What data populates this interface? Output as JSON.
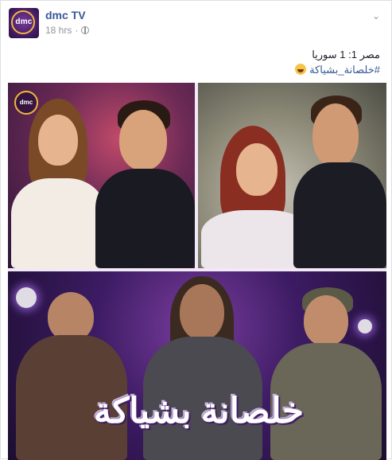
{
  "post": {
    "page_name": "dmc TV",
    "timestamp": "18 hrs",
    "text_line1": "مصر 1: 1 سوريا",
    "hashtag": "#خلصانة_بشياكة"
  },
  "avatar": {
    "logo_text": "dmc"
  },
  "image": {
    "badge_text": "dmc",
    "title_art": "خلصانة بشياكة"
  },
  "icons": {
    "globe": "globe-icon",
    "chevron": "chevron-down-icon",
    "emoji": "laughing-emoji-icon"
  },
  "colors": {
    "link": "#365899",
    "meta": "#90949c",
    "brand_purple": "#3d1a5e",
    "brand_gold": "#f0b63c"
  }
}
